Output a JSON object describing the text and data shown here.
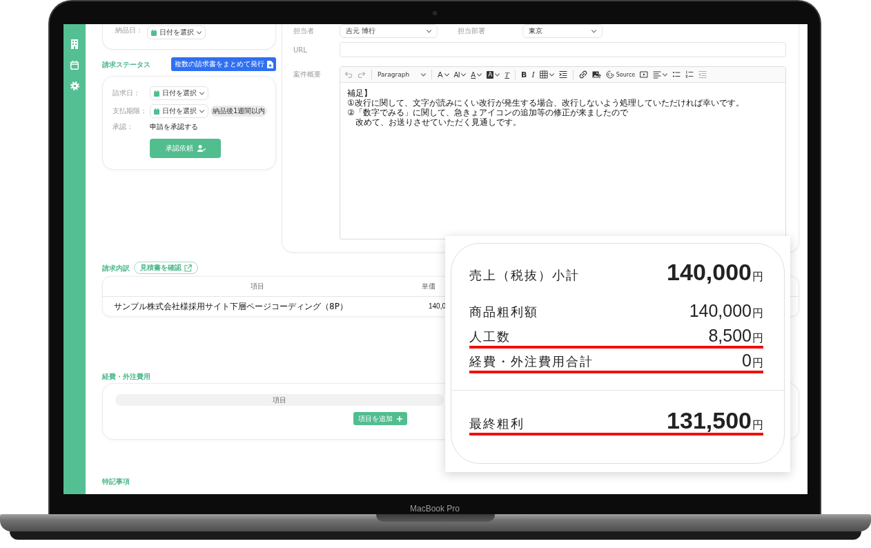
{
  "device": {
    "label": "MacBook Pro"
  },
  "delivery": {
    "label": "納品日：",
    "date_select": "日付を選択"
  },
  "billing_status": {
    "title": "請求ステータス",
    "bulk_issue_button": "複数の請求書をまとめて発行",
    "fields": [
      {
        "kind": "date",
        "label": "請求日：",
        "value": "日付を選択"
      },
      {
        "kind": "date",
        "label": "支払期限：",
        "value": "日付を選択",
        "badge": "納品後1週間以内"
      },
      {
        "kind": "text",
        "label": "承認：",
        "value": "申請を承認する"
      }
    ],
    "approval_button": "承認依頼"
  },
  "project": {
    "assignee_label": "担当者",
    "assignee": "吉元 博行",
    "department_label": "担当部署",
    "department": "東京",
    "url_label": "URL",
    "summary_label": "案件概要",
    "editor": {
      "toolbar": [
        {
          "kind": "undo",
          "disabled": true,
          "dropdown": false
        },
        {
          "kind": "redo",
          "disabled": true,
          "dropdown": false
        },
        {
          "kind": "separator"
        },
        {
          "kind": "heading",
          "label": "Paragraph",
          "disabled": false,
          "dropdown": true
        },
        {
          "kind": "separator"
        },
        {
          "kind": "font-size",
          "label": "A",
          "disabled": false,
          "dropdown": true
        },
        {
          "kind": "font-family",
          "label": "AI",
          "disabled": false,
          "dropdown": true
        },
        {
          "kind": "font-color",
          "label": "A",
          "disabled": false,
          "dropdown": true
        },
        {
          "kind": "highlight",
          "label": "A",
          "disabled": false,
          "dropdown": true
        },
        {
          "kind": "clear-format",
          "label": "T",
          "disabled": false,
          "dropdown": false
        },
        {
          "kind": "separator"
        },
        {
          "kind": "bold",
          "label": "B",
          "disabled": false,
          "dropdown": false
        },
        {
          "kind": "italic",
          "label": "I",
          "disabled": false,
          "dropdown": false
        },
        {
          "kind": "table",
          "disabled": false,
          "dropdown": true
        },
        {
          "kind": "indent",
          "disabled": false,
          "dropdown": false
        },
        {
          "kind": "separator"
        },
        {
          "kind": "link",
          "disabled": false,
          "dropdown": false
        },
        {
          "kind": "image",
          "disabled": false,
          "dropdown": false
        },
        {
          "kind": "source",
          "label": "Source",
          "disabled": false,
          "dropdown": false
        },
        {
          "kind": "media",
          "disabled": false,
          "dropdown": false
        },
        {
          "kind": "align",
          "disabled": false,
          "dropdown": true
        },
        {
          "kind": "bulleted-list",
          "disabled": false,
          "dropdown": false
        },
        {
          "kind": "numbered-list",
          "disabled": false,
          "dropdown": false
        },
        {
          "kind": "outdent",
          "disabled": true,
          "dropdown": false
        }
      ],
      "lines": [
        "補足】",
        "①改行に関して、文字が読みにくい改行が発生する場合、改行しないよう処理していただければ幸いです。",
        "②「数字でみる」に関して、急きょアイコンの追加等の修正が来ましたので",
        "　改めて、お送りさせていただく見通しです。"
      ]
    }
  },
  "invoice_breakdown": {
    "title": "請求内訳",
    "estimate_button": "見積書を確認",
    "columns": [
      "項目",
      "単価"
    ],
    "rows": [
      [
        "サンプル株式会社様採用サイト下層ページコーディング（8P）",
        "140,0"
      ]
    ]
  },
  "expenses": {
    "title": "経費・外注費用",
    "columns": [
      "項目"
    ],
    "add_button": "項目を追加"
  },
  "notes": {
    "title": "特記事項"
  },
  "profit_summary": {
    "sections": [
      {
        "rows": [
          {
            "kind": "subtotal",
            "label": "売上（税抜）小計",
            "value": "140,000",
            "unit": "円",
            "underlined": false
          },
          {
            "kind": "item",
            "label": "商品粗利額",
            "value": "140,000",
            "unit": "円",
            "underlined": false
          },
          {
            "kind": "item",
            "label": "人工数",
            "value": "8,500",
            "unit": "円",
            "underlined": true
          },
          {
            "kind": "item",
            "label": "経費・外注費用合計",
            "value": "0",
            "unit": "円",
            "underlined": true
          }
        ]
      },
      {
        "rows": [
          {
            "kind": "total",
            "label": "最終粗利",
            "value": "131,500",
            "unit": "円",
            "underlined": true
          }
        ]
      }
    ]
  }
}
